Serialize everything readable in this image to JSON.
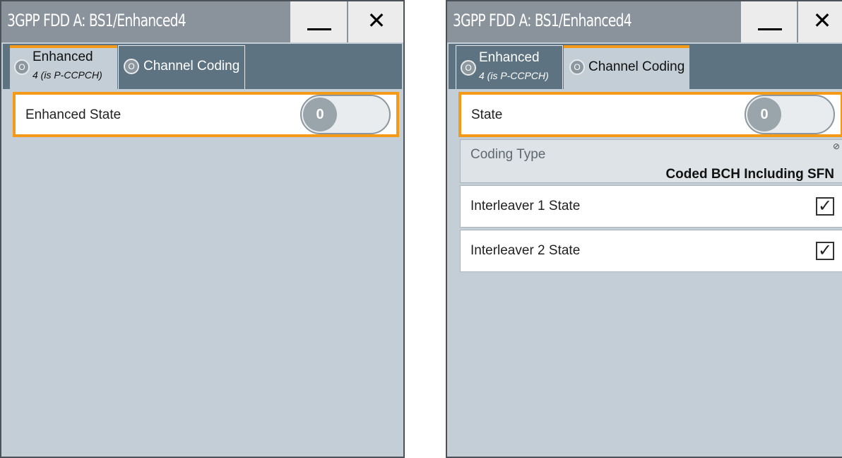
{
  "left": {
    "title": "3GPP FDD A: BS1/Enhanced4",
    "tabs": [
      {
        "indicator": "O",
        "label": "Enhanced",
        "sublabel": "4 (is P-CCPCH)"
      },
      {
        "indicator": "O",
        "label": "Channel Coding"
      }
    ],
    "enhanced_state": {
      "label": "Enhanced State",
      "toggle": "0"
    }
  },
  "right": {
    "title": "3GPP FDD A: BS1/Enhanced4",
    "tabs": [
      {
        "indicator": "O",
        "label": "Enhanced",
        "sublabel": "4 (is P-CCPCH)"
      },
      {
        "indicator": "O",
        "label": "Channel Coding"
      }
    ],
    "state": {
      "label": "State",
      "toggle": "0"
    },
    "coding_type": {
      "label": "Coding Type",
      "value": "Coded BCH Including SFN",
      "readonly_icon": "⊘"
    },
    "interleaver1": {
      "label": "Interleaver 1 State",
      "check": "✓",
      "checked": true
    },
    "interleaver2": {
      "label": "Interleaver 2 State",
      "check": "✓",
      "checked": true
    }
  },
  "window_controls": {
    "minimize_icon": "minimize-icon",
    "close_glyph": "✕"
  },
  "colors": {
    "titlebar": "#8a939b",
    "tabbar": "#5d7381",
    "panel": "#c3ced6",
    "focus": "#f39a19"
  }
}
